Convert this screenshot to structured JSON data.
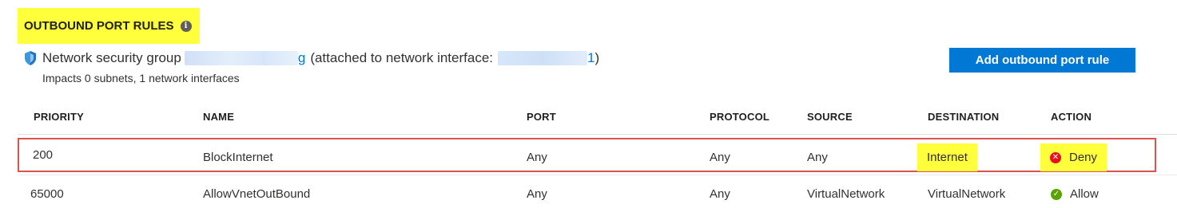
{
  "section": {
    "title": "OUTBOUND PORT RULES",
    "info_glyph": "i"
  },
  "nsg": {
    "label": "Network security group",
    "link_suffix": "g",
    "attached_text": "(attached to network interface:",
    "interface_suffix": "1",
    "close_paren": ")",
    "impacts": "Impacts 0 subnets, 1 network interfaces"
  },
  "add_button": {
    "label": "Add outbound port rule"
  },
  "columns": [
    "PRIORITY",
    "NAME",
    "PORT",
    "PROTOCOL",
    "SOURCE",
    "DESTINATION",
    "ACTION"
  ],
  "rules": [
    {
      "priority": "200",
      "name": "BlockInternet",
      "port": "Any",
      "protocol": "Any",
      "source": "Any",
      "destination": "Internet",
      "action": "Deny",
      "action_icon": "deny-x-icon",
      "action_glyph": "✕"
    },
    {
      "priority": "65000",
      "name": "AllowVnetOutBound",
      "port": "Any",
      "protocol": "Any",
      "source": "VirtualNetwork",
      "destination": "VirtualNetwork",
      "action": "Allow",
      "action_icon": "allow-check-icon",
      "action_glyph": "✓"
    }
  ],
  "colors": {
    "accent": "#0078d4",
    "highlight": "#ffff3b",
    "deny": "#e81123",
    "allow": "#57a300",
    "row_outline": "#d9534f"
  }
}
